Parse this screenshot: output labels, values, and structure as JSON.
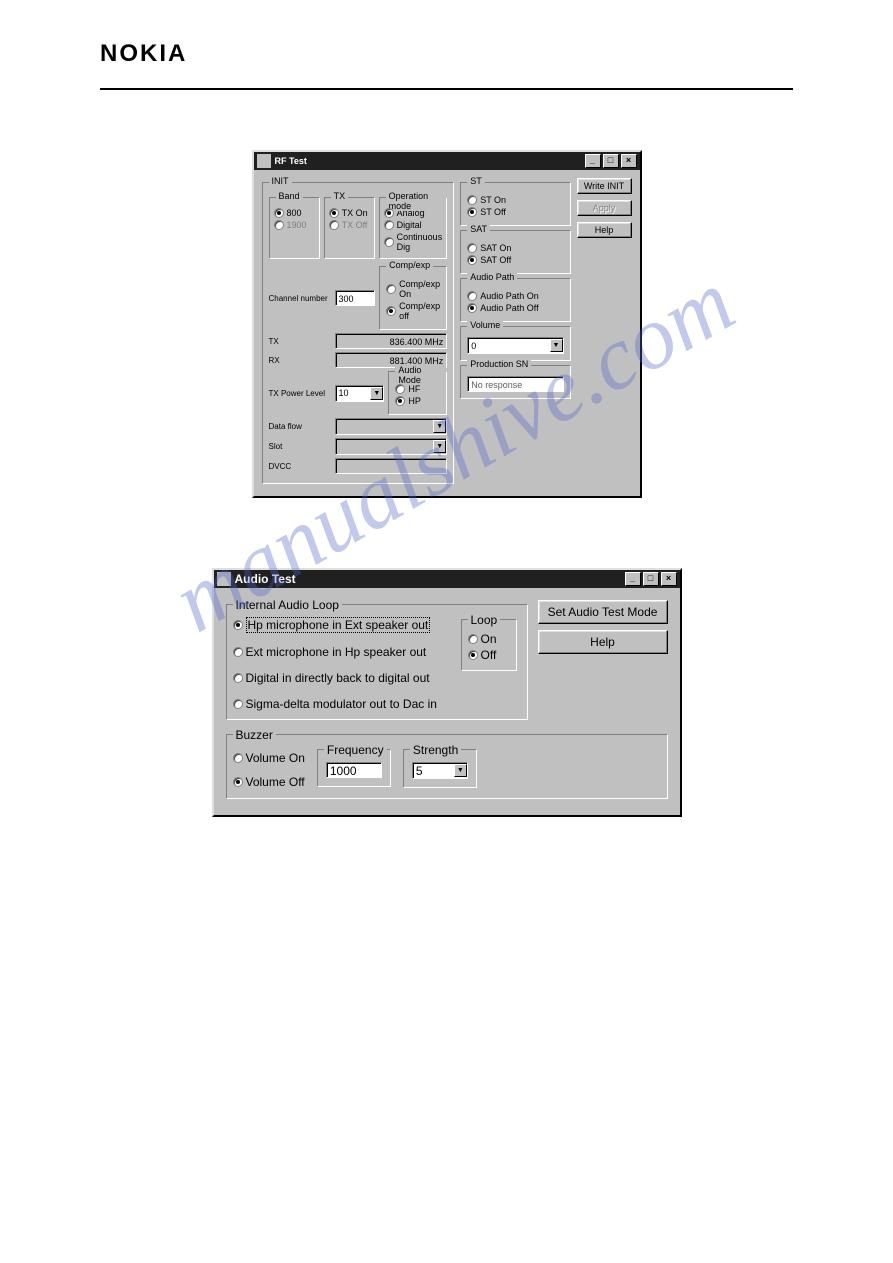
{
  "header": {
    "brand": "NOKIA"
  },
  "watermark": "manualshive.com",
  "rf": {
    "title": "RF Test",
    "init_legend": "INIT",
    "band": {
      "legend": "Band",
      "opt1": "800",
      "opt2": "1900"
    },
    "tx": {
      "legend": "TX",
      "opt1": "TX On",
      "opt2": "TX Off"
    },
    "opmode": {
      "legend": "Operation mode",
      "opt1": "Analog",
      "opt2": "Digital",
      "opt3": "Continuous Dig"
    },
    "labels": {
      "channel": "Channel number",
      "tx_freq": "TX",
      "rx_freq": "RX",
      "txpower": "TX Power Level",
      "dataflow": "Data flow",
      "slot": "Slot",
      "dvcc": "DVCC"
    },
    "values": {
      "channel": "300",
      "tx_freq": "836.400 MHz",
      "rx_freq": "881.400 MHz",
      "txpower": "10",
      "dataflow": "",
      "slot": "",
      "dvcc": ""
    },
    "compexp": {
      "legend": "Comp/exp",
      "opt1": "Comp/exp On",
      "opt2": "Comp/exp off"
    },
    "audiomode": {
      "legend": "Audio Mode",
      "opt1": "HF",
      "opt2": "HP"
    },
    "st": {
      "legend": "ST",
      "opt1": "ST On",
      "opt2": "ST Off"
    },
    "sat": {
      "legend": "SAT",
      "opt1": "SAT On",
      "opt2": "SAT Off"
    },
    "audiopath": {
      "legend": "Audio Path",
      "opt1": "Audio Path On",
      "opt2": "Audio Path Off"
    },
    "volume": {
      "legend": "Volume",
      "value": "0"
    },
    "prodsn": {
      "legend": "Production SN",
      "value": "No response"
    },
    "buttons": {
      "write": "Write INIT",
      "apply": "Apply",
      "help": "Help"
    }
  },
  "audio": {
    "title": "Audio Test",
    "loopgroup": {
      "legend": "Internal Audio Loop",
      "opt1": "Hp microphone in Ext speaker out",
      "opt2": "Ext microphone in Hp speaker out",
      "opt3": "Digital in directly back to digital out",
      "opt4": "Sigma-delta modulator out to Dac in"
    },
    "loop": {
      "legend": "Loop",
      "on": "On",
      "off": "Off"
    },
    "buttons": {
      "set": "Set Audio Test Mode",
      "help": "Help"
    },
    "buzzer": {
      "legend": "Buzzer",
      "volon": "Volume On",
      "voloff": "Volume Off",
      "freq_legend": "Frequency",
      "freq_value": "1000",
      "str_legend": "Strength",
      "str_value": "5"
    }
  }
}
